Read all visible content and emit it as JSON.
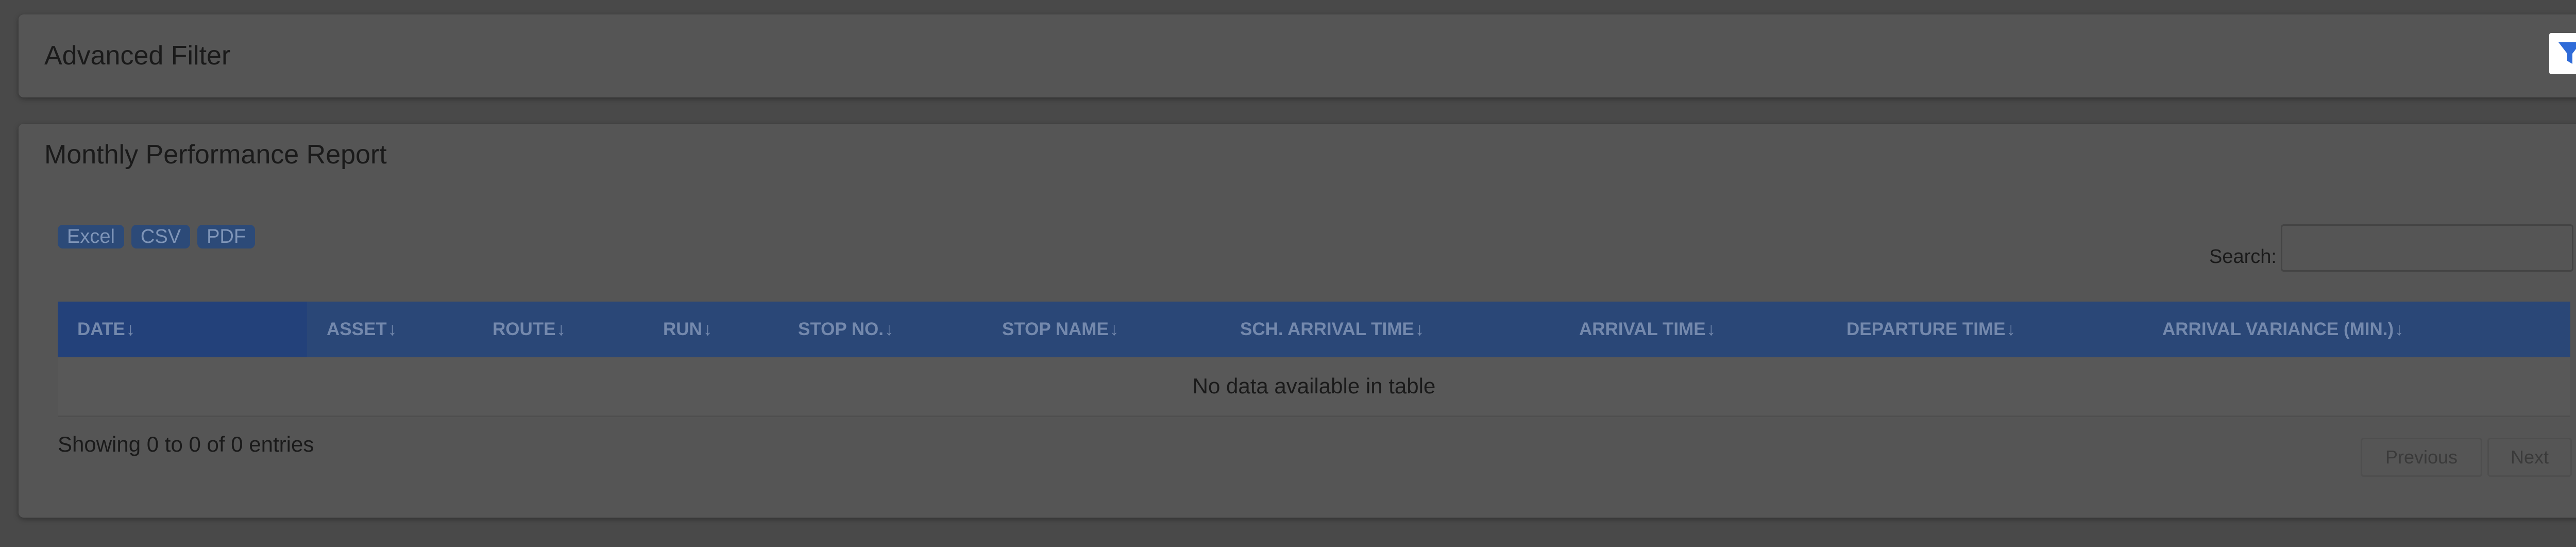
{
  "filter_panel": {
    "title": "Advanced Filter",
    "icon": "filter-icon",
    "icon_color": "#2f6bd8"
  },
  "report": {
    "title": "Monthly Performance Report",
    "export_buttons": [
      "Excel",
      "CSV",
      "PDF"
    ],
    "search": {
      "label": "Search:",
      "value": "",
      "placeholder": ""
    },
    "table": {
      "columns": [
        "DATE",
        "ASSET",
        "ROUTE",
        "RUN",
        "STOP NO.",
        "STOP NAME",
        "SCH. ARRIVAL TIME",
        "ARRIVAL TIME",
        "DEPARTURE TIME",
        "ARRIVAL VARIANCE (MIN.)"
      ],
      "sort_indicator": "↓",
      "empty_message": "No data available in table"
    },
    "info_text": "Showing 0 to 0 of 0 entries",
    "pagination": {
      "previous": "Previous",
      "next": "Next"
    }
  },
  "colors": {
    "header_bg": "#2a4777",
    "accent": "#2f6bd8"
  }
}
